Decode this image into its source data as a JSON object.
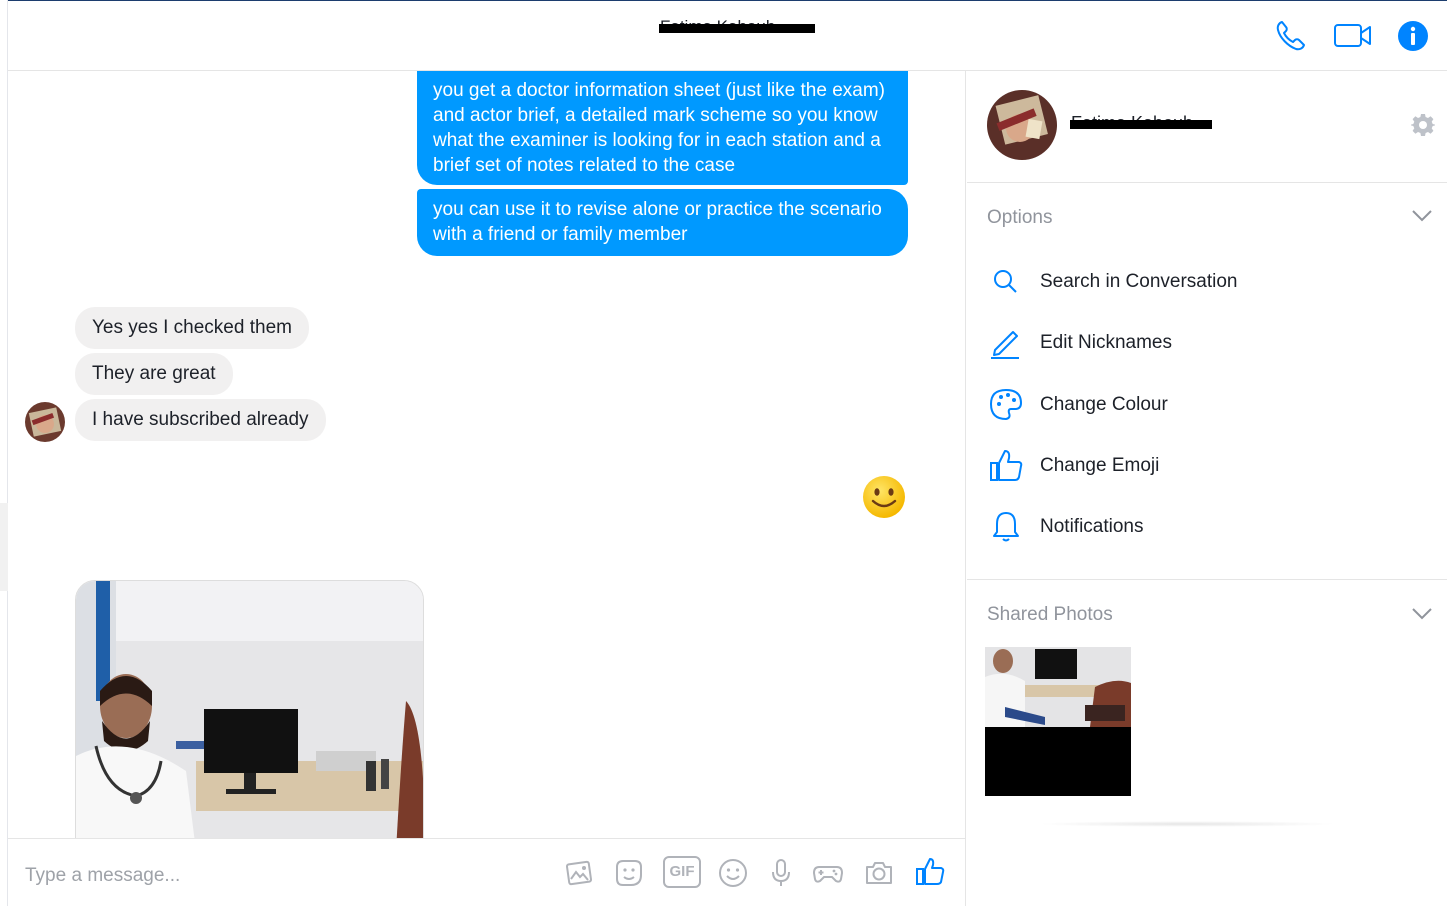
{
  "conversation": {
    "contact_name": "Fatima Kaboub"
  },
  "header": {
    "call_icon": "phone-icon",
    "video_icon": "video-camera-icon",
    "info_icon": "info-icon"
  },
  "messages": {
    "outgoing": [
      "you get a doctor information sheet (just like the exam) and actor brief, a detailed mark scheme so you know what the examiner is looking for in each station and a brief set of notes related to the case",
      "you can use it to revise alone or practice the scenario with a friend or family member"
    ],
    "incoming": [
      "Yes yes I checked them",
      "They are great",
      "I have subscribed already"
    ],
    "outgoing_emoji": "slightly-smiling-face"
  },
  "composer": {
    "placeholder": "Type a message...",
    "icons": [
      "image-icon",
      "sticker-icon",
      "gif-icon",
      "emoji-icon",
      "microphone-icon",
      "game-controller-icon",
      "camera-icon",
      "thumbs-up-icon"
    ],
    "gif_label": "GIF"
  },
  "panel": {
    "options_header": "Options",
    "options": [
      {
        "label": "Search in Conversation",
        "icon": "search-icon"
      },
      {
        "label": "Edit Nicknames",
        "icon": "pencil-icon"
      },
      {
        "label": "Change Colour",
        "icon": "palette-icon"
      },
      {
        "label": "Change Emoji",
        "icon": "thumbs-up-icon"
      },
      {
        "label": "Notifications",
        "icon": "bell-icon"
      }
    ],
    "shared_photos_header": "Shared Photos"
  },
  "colors": {
    "accent": "#0084ff",
    "outgoing_bubble": "#0099ff",
    "incoming_bubble": "#f1f0f0"
  }
}
